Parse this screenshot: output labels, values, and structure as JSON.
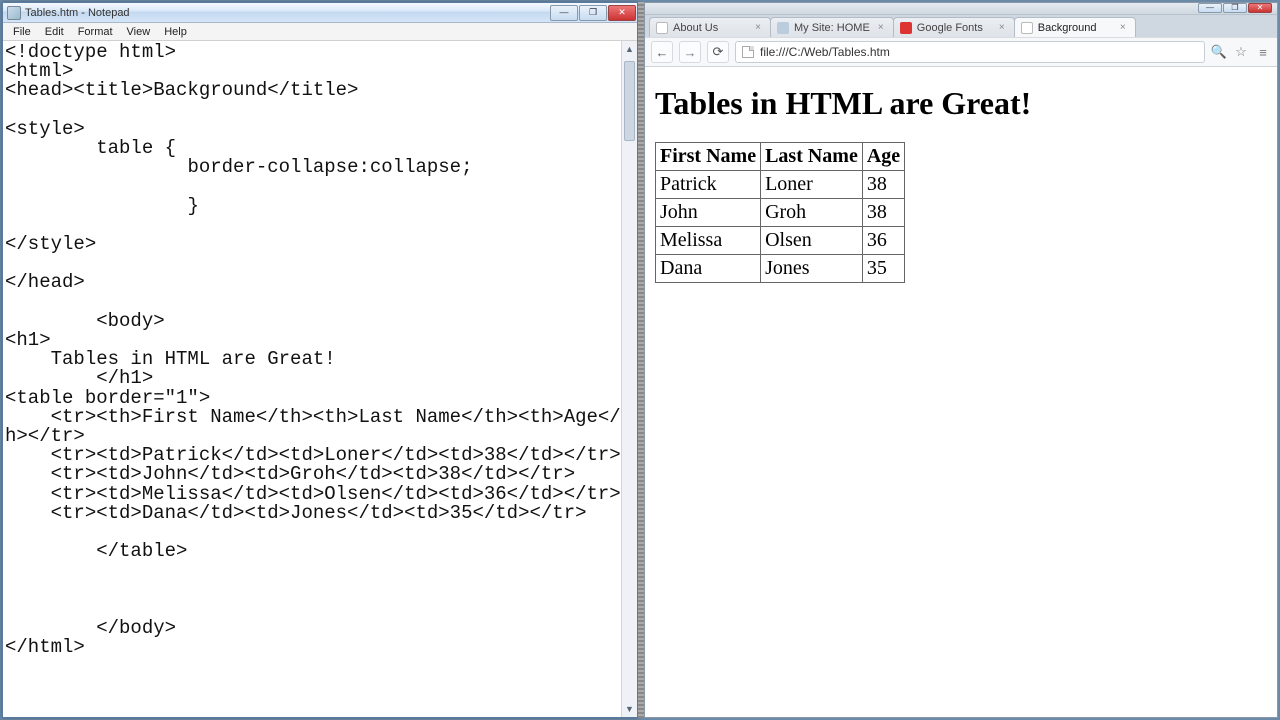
{
  "notepad": {
    "title": "Tables.htm - Notepad",
    "menu": {
      "file": "File",
      "edit": "Edit",
      "format": "Format",
      "view": "View",
      "help": "Help"
    },
    "content": "<!doctype html>\n<html>\n<head><title>Background</title>\n\n<style>\n        table {\n                border-collapse:collapse;\n\n                }\n\n</style>\n\n</head>\n\n        <body>\n<h1>\n    Tables in HTML are Great!\n        </h1>\n<table border=\"1\">\n    <tr><th>First Name</th><th>Last Name</th><th>Age</th></tr>\n    <tr><td>Patrick</td><td>Loner</td><td>38</td></tr>\n    <tr><td>John</td><td>Groh</td><td>38</td></tr>\n    <tr><td>Melissa</td><td>Olsen</td><td>36</td></tr>\n    <tr><td>Dana</td><td>Jones</td><td>35</td></tr>\n\n        </table>\n\n\n\n        </body>\n</html>"
  },
  "chrome": {
    "tabs": [
      {
        "label": "About Us"
      },
      {
        "label": "My Site: HOME"
      },
      {
        "label": "Google Fonts"
      },
      {
        "label": "Background"
      }
    ],
    "url": "file:///C:/Web/Tables.htm",
    "page": {
      "heading": "Tables in HTML are Great!",
      "headers": {
        "first": "First Name",
        "last": "Last Name",
        "age": "Age"
      },
      "rows": [
        {
          "first": "Patrick",
          "last": "Loner",
          "age": "38"
        },
        {
          "first": "John",
          "last": "Groh",
          "age": "38"
        },
        {
          "first": "Melissa",
          "last": "Olsen",
          "age": "36"
        },
        {
          "first": "Dana",
          "last": "Jones",
          "age": "35"
        }
      ]
    }
  },
  "win": {
    "min": "—",
    "max": "❐",
    "close": "✕"
  }
}
